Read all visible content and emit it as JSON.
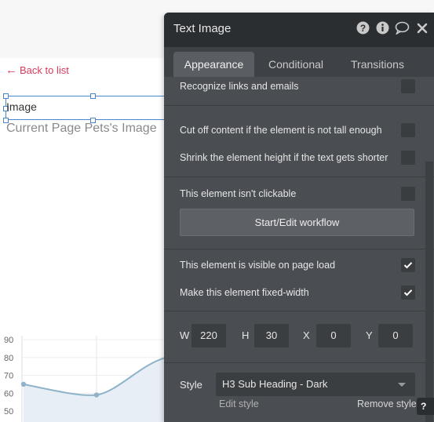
{
  "page": {
    "back_link": "Back to list",
    "element_label": "Image",
    "element_caption": "Current Page Pets's Image"
  },
  "chart_data": {
    "type": "line",
    "y_ticks": [
      "90",
      "80",
      "70",
      "60",
      "50"
    ],
    "ylim": [
      45,
      95
    ],
    "x": [
      0,
      1,
      2
    ],
    "series": [
      {
        "values": [
          65,
          59,
          80
        ]
      }
    ],
    "grid": true,
    "colors": {
      "line": "#8fb3c8",
      "fill": "#e8eef5",
      "point": "#8fb3c8"
    }
  },
  "panel": {
    "title": "Text Image",
    "header_icons": [
      "help-icon",
      "info-icon",
      "comment-icon",
      "close-icon"
    ],
    "tabs": [
      {
        "label": "Appearance",
        "active": true
      },
      {
        "label": "Conditional",
        "active": false
      },
      {
        "label": "Transitions",
        "active": false
      }
    ],
    "options": {
      "recognize_links": {
        "label": "Recognize links and emails",
        "checked": false
      },
      "cut_off": {
        "label": "Cut off content if the element is not tall enough",
        "checked": false
      },
      "shrink": {
        "label": "Shrink the element height if the text gets shorter",
        "checked": false
      },
      "not_clickable": {
        "label": "This element isn't clickable",
        "checked": false
      },
      "visible_on_load": {
        "label": "This element is visible on page load",
        "checked": true
      },
      "fixed_width": {
        "label": "Make this element fixed-width",
        "checked": true
      }
    },
    "workflow_button": "Start/Edit workflow",
    "dimensions": {
      "w_label": "W",
      "w_value": "220",
      "h_label": "H",
      "h_value": "30",
      "x_label": "X",
      "x_value": "0",
      "y_label": "Y",
      "y_value": "0"
    },
    "style": {
      "label": "Style",
      "selected": "H3 Sub Heading - Dark",
      "edit_link": "Edit style",
      "remove_link": "Remove style"
    }
  },
  "help_button": "?",
  "colors": {
    "accent_link": "#d93a5b",
    "selection": "#4a86c8",
    "panel_bg": "#4a4e52",
    "panel_header": "#2b2e31"
  }
}
